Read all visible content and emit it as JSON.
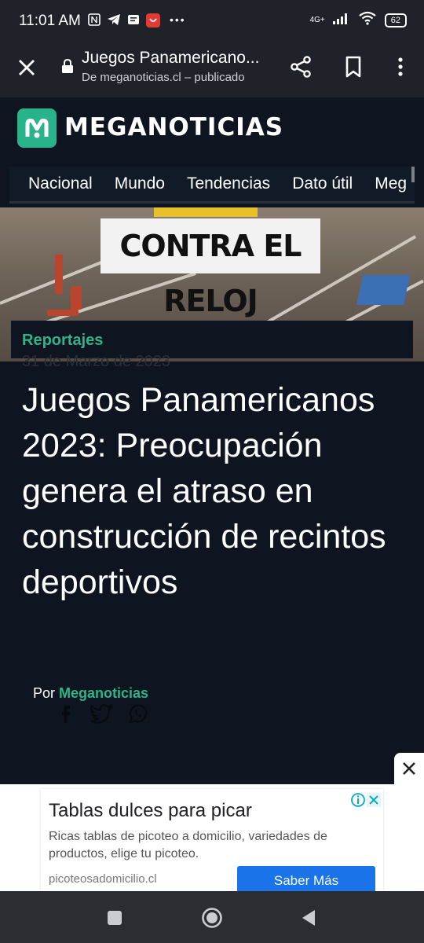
{
  "status": {
    "time": "11:01 AM",
    "network": "4G+",
    "battery": "62"
  },
  "browser": {
    "title": "Juegos Panamericano...",
    "subtitle": "De meganoticias.cl – publicado"
  },
  "site": {
    "brand": "MEGANOTICIAS",
    "brand_color": "#29b38a"
  },
  "nav": {
    "items": [
      "Nacional",
      "Mundo",
      "Tendencias",
      "Dato útil",
      "Meg"
    ]
  },
  "hero": {
    "sign_text": "CONTRA EL RELOJ"
  },
  "article": {
    "category": "Reportajes",
    "date": "31 de Marzo de 2023",
    "headline": "Juegos Panamericanos 2023: Preocupación genera el atraso en construcción de recintos deportivos",
    "byline_prefix": "Por",
    "author": "Meganoticias",
    "share_icons": [
      "facebook-icon",
      "twitter-icon",
      "whatsapp-icon"
    ]
  },
  "ad": {
    "title": "Tablas dulces para picar",
    "text": "Ricas tablas de picoteo a domicilio, variedades de productos, elige tu picoteo.",
    "domain": "picoteosadomicilio.cl",
    "cta": "Saber Más",
    "cta_color": "#1a73e8"
  }
}
